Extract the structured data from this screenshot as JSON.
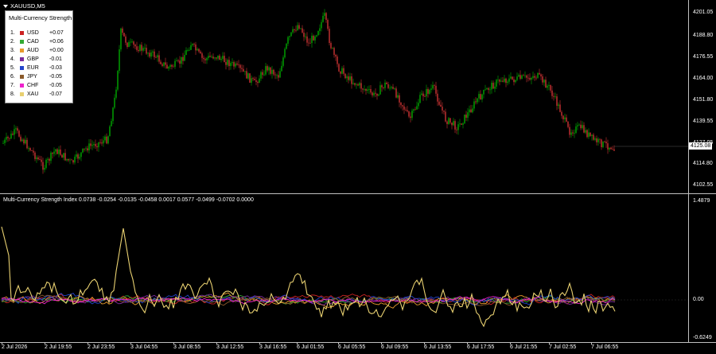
{
  "chart": {
    "symbol_title": "XAUUSD,M5",
    "price_labels": [
      "4201.05",
      "4188.80",
      "4176.55",
      "4164.00",
      "4151.80",
      "4139.55",
      "4127.05",
      "4114.80",
      "4102.55"
    ],
    "current_price": "4125.08",
    "candle_up_color": "#00aa00",
    "candle_down_color": "#cc3333"
  },
  "legend": {
    "title": "Multi-Currency Strength",
    "items": [
      {
        "num": "1.",
        "code": "USD",
        "value": "+0.07",
        "color": "#cc2222"
      },
      {
        "num": "2.",
        "code": "CAD",
        "value": "+0.06",
        "color": "#33aa33"
      },
      {
        "num": "3.",
        "code": "AUD",
        "value": "+0.00",
        "color": "#e89a2c"
      },
      {
        "num": "4.",
        "code": "GBP",
        "value": "-0.01",
        "color": "#7a2a9a"
      },
      {
        "num": "5.",
        "code": "EUR",
        "value": "-0.03",
        "color": "#2244cc"
      },
      {
        "num": "6.",
        "code": "JPY",
        "value": "-0.05",
        "color": "#8b5a2b"
      },
      {
        "num": "7.",
        "code": "CHF",
        "value": "-0.05",
        "color": "#ee22cc"
      },
      {
        "num": "8.",
        "code": "XAU",
        "value": "-0.07",
        "color": "#e8d070"
      }
    ]
  },
  "indicator": {
    "title": "Multi-Currency Strength Index 0.0738 -0.0254 -0.0135 -0.0458 0.0017 0.0577 -0.0499 -0.0702 0.0000",
    "labels": [
      "1.4879",
      "0.00",
      "-0.6249"
    ]
  },
  "time_axis": [
    "2 Jul 2026",
    "2 Jul 19:55",
    "2 Jul 23:55",
    "3 Jul 04:55",
    "3 Jul 08:55",
    "3 Jul 12:55",
    "3 Jul 16:55",
    "6 Jul 01:55",
    "6 Jul 05:55",
    "6 Jul 09:55",
    "6 Jul 13:55",
    "6 Jul 17:55",
    "6 Jul 21:55",
    "7 Jul 02:55",
    "7 Jul 06:55"
  ]
}
